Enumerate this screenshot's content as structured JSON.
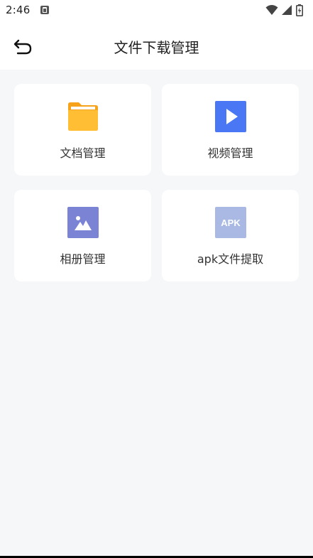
{
  "status_bar": {
    "time": "2:46",
    "icons": [
      "app-notification-icon",
      "wifi-icon",
      "signal-icon",
      "battery-icon"
    ]
  },
  "app_bar": {
    "back_icon": "back-arrow-icon",
    "title": "文件下载管理"
  },
  "cards": [
    {
      "label": "文档管理",
      "icon": "folder-icon",
      "color": "#FFB629"
    },
    {
      "label": "视频管理",
      "icon": "video-play-icon",
      "color": "#4A78F5"
    },
    {
      "label": "相册管理",
      "icon": "image-icon",
      "color": "#7B83D4"
    },
    {
      "label": "apk文件提取",
      "icon": "apk-icon",
      "icon_text": "APK",
      "color": "#A9B9E3"
    }
  ],
  "colors": {
    "background": "#f6f7f9",
    "card_background": "#ffffff"
  }
}
